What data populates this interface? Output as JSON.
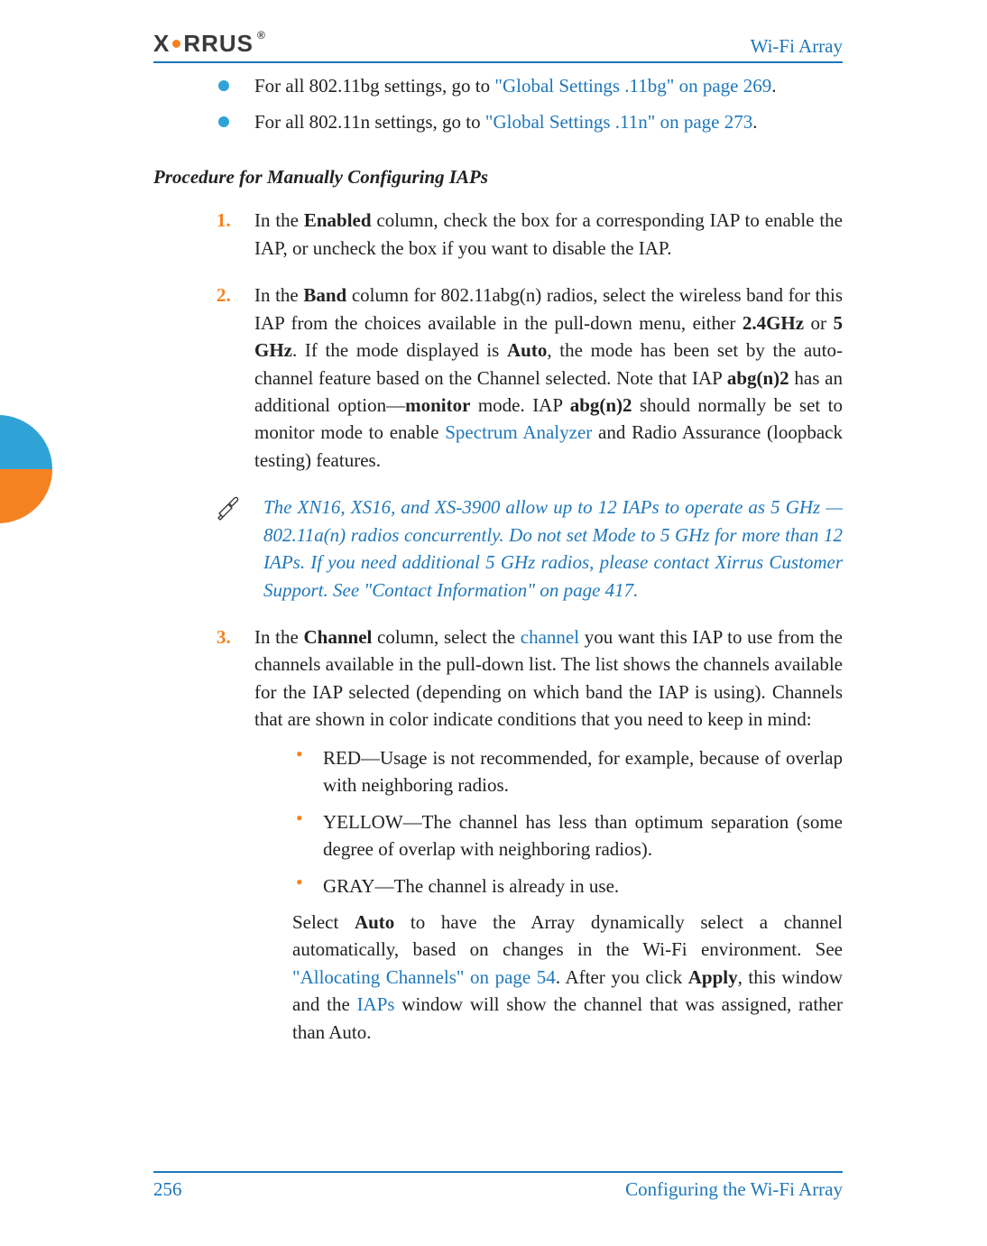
{
  "header": {
    "logo_prefix": "X",
    "logo_suffix": "RRUS",
    "trademark": "®",
    "title": "Wi-Fi Array"
  },
  "side_tab": {
    "present": true
  },
  "intro_bullets": [
    {
      "prefix": "For all 802.11bg settings, go to ",
      "link": "\"Global Settings .11bg\" on page 269",
      "suffix": "."
    },
    {
      "prefix": "For all 802.11n settings, go to ",
      "link": "\"Global Settings .11n\" on page 273",
      "suffix": "."
    }
  ],
  "subheading": "Procedure for Manually Configuring IAPs",
  "steps": {
    "s1": {
      "pre": "In the ",
      "bold1": "Enabled",
      "post": " column, check the box for a corresponding IAP to enable the IAP, or uncheck the box if you want to disable the IAP."
    },
    "s2": {
      "t1": "In the ",
      "b_band": "Band",
      "t2": " column for 802.11abg(n) radios, select the wireless band for this IAP from the choices available in the pull-down menu, either ",
      "b_24": "2.4GHz",
      "t3": " or ",
      "b_5": "5 GHz",
      "t4": ". If the mode displayed is ",
      "b_auto": "Auto",
      "t5": ", the mode has been set by the auto-channel feature based on the Channel selected. Note that IAP ",
      "b_abg": "abg(n)2",
      "t6": " has an additional option—",
      "b_mon": "monitor",
      "t7": " mode. IAP ",
      "b_abg2": "abg(n)2",
      "t8": " should normally be set to monitor mode to enable ",
      "link_spec": "Spectrum Analyzer",
      "t9": " and Radio Assurance (loopback testing) features."
    },
    "s3": {
      "t1": "In the ",
      "b_chan": "Channel",
      "t2": " column, select the ",
      "link_channel": "channel",
      "t3": " you want this IAP to use from the channels available in the pull-down list. The list shows the channels available for the IAP selected (depending on which band the IAP is using). Channels that are shown in color indicate conditions that you need to keep in mind:",
      "colors": {
        "red": "RED—Usage is not recommended, for example, because of overlap with neighboring radios.",
        "yellow": "YELLOW—The channel has less than optimum separation (some degree of overlap with neighboring radios).",
        "gray": "GRAY—The channel is already in use."
      },
      "p2_t1": "Select ",
      "p2_bold_auto": "Auto",
      "p2_t2": " to have the Array dynamically select a channel automatically, based on changes in the Wi-Fi environment. See ",
      "p2_link_alloc": "\"Allocating Channels\" on page 54",
      "p2_t3": ". After you click ",
      "p2_bold_apply": "Apply",
      "p2_t4": ", this window and the ",
      "p2_link_iaps": "IAPs",
      "p2_t5": " window will show the channel that was assigned, rather than Auto."
    }
  },
  "note": {
    "text": "The XN16, XS16, and XS-3900 allow up to 12 IAPs to operate as 5 GHz — 802.11a(n) radios concurrently. Do not set Mode to 5 GHz for more than 12 IAPs. If you need additional 5 GHz radios, please contact Xirrus Customer Support. See \"Contact Information\" on page 417."
  },
  "footer": {
    "page": "256",
    "section": "Configuring the Wi-Fi Array"
  }
}
